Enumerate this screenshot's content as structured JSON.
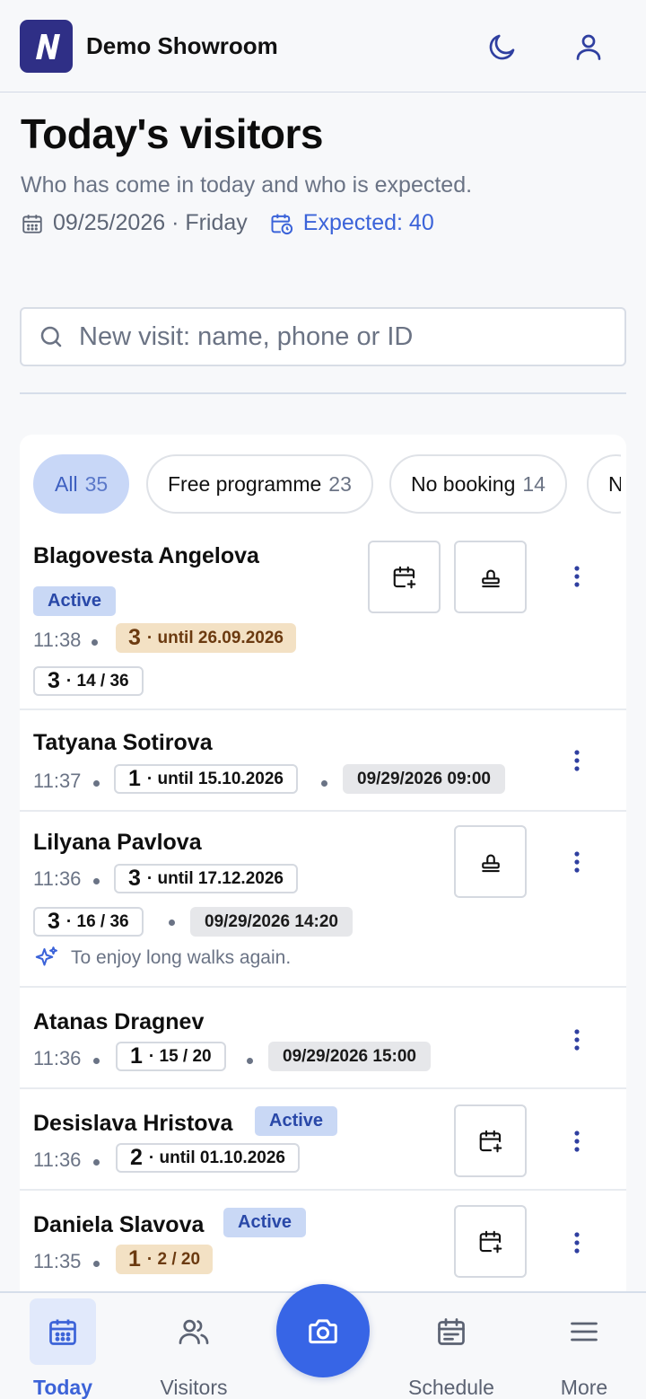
{
  "header": {
    "brand": "Demo Showroom",
    "logo_letter": "N",
    "icons": [
      "moon-icon",
      "user-icon"
    ]
  },
  "page": {
    "title": "Today's visitors",
    "subtitle": "Who has come in today and who is expected.",
    "date_text": "09/25/2026 · Friday",
    "expected_text": "Expected: 40"
  },
  "search": {
    "placeholder": "New visit: name, phone or ID"
  },
  "filters": [
    {
      "label": "All",
      "count": "35",
      "active": true
    },
    {
      "label": "Free programme",
      "count": "23",
      "active": false
    },
    {
      "label": "No booking",
      "count": "14",
      "active": false
    },
    {
      "label": "N",
      "count": "",
      "active": false
    }
  ],
  "visitors": [
    {
      "name": "Blagovesta Angelova",
      "badge": "Active",
      "time": "11:38",
      "tag1_num": "3",
      "tag1_text": "· until 26.09.2026",
      "tag2_num": "3",
      "tag2_text": "· 14 / 36"
    },
    {
      "name": "Tatyana Sotirova",
      "time": "11:37",
      "tag1_num": "1",
      "tag1_text": "· until 15.10.2026",
      "appointment": "09/29/2026 09:00"
    },
    {
      "name": "Lilyana Pavlova",
      "time": "11:36",
      "tag1_num": "3",
      "tag1_text": "· until 17.12.2026",
      "tag2_num": "3",
      "tag2_text": "· 16 / 36",
      "appointment": "09/29/2026 14:20",
      "note": "To enjoy long walks again."
    },
    {
      "name": "Atanas Dragnev",
      "time": "11:36",
      "tag1_num": "1",
      "tag1_text": "· 15 / 20",
      "appointment": "09/29/2026 15:00"
    },
    {
      "name": "Desislava Hristova",
      "badge": "Active",
      "time": "11:36",
      "tag1_num": "2",
      "tag1_text": "· until 01.10.2026"
    },
    {
      "name": "Daniela Slavova",
      "badge": "Active",
      "time": "11:35",
      "tag1_num": "1",
      "tag1_text": "· 2 / 20"
    }
  ],
  "nav": {
    "today": "Today",
    "visitors": "Visitors",
    "schedule": "Schedule",
    "more": "More"
  },
  "colors": {
    "accent": "#3765e6",
    "badge_bg": "#c9d8f5",
    "amber_bg": "#f3e1c4",
    "logo_bg": "#2f2f86"
  }
}
